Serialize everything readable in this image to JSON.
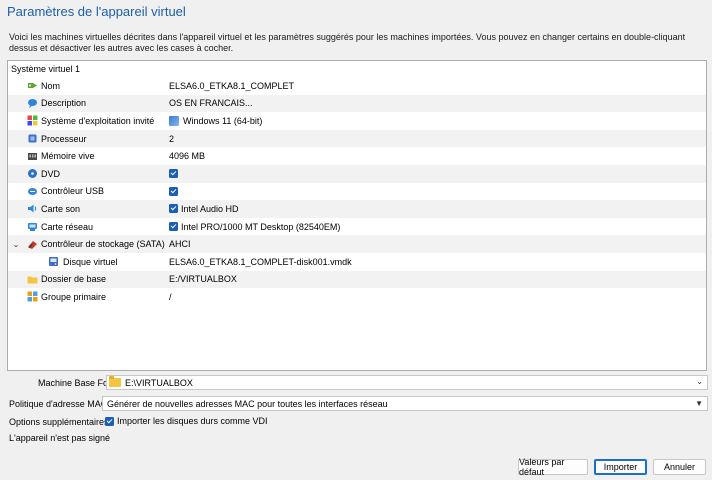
{
  "window": {
    "title": "Paramètres de l'appareil virtuel",
    "description": "Voici les machines virtuelles décrites dans l'appareil virtuel et les paramètres suggérés pour les machines importées. Vous pouvez en changer certains en double-cliquant dessus et désactiver les autres avec les cases à cocher."
  },
  "system": {
    "label": "Système virtuel 1",
    "rows": [
      {
        "name": "nom",
        "icon": "name-tag-icon",
        "label": "Nom",
        "value": "ELSA6.0_ETKA8.1_COMPLET"
      },
      {
        "name": "description",
        "icon": "speech-bubble-icon",
        "label": "Description",
        "value": "OS EN FRANCAIS..."
      },
      {
        "name": "guest-os",
        "icon": "os-windows-icon",
        "label": "Système d'exploitation invité",
        "value": "Windows 11 (64-bit)"
      },
      {
        "name": "processor",
        "icon": "cpu-icon",
        "label": "Processeur",
        "value": "2"
      },
      {
        "name": "memory",
        "icon": "ram-icon",
        "label": "Mémoire vive",
        "value": "4096 MB"
      },
      {
        "name": "dvd",
        "icon": "dvd-icon",
        "label": "DVD",
        "value": ""
      },
      {
        "name": "usb",
        "icon": "usb-icon",
        "label": "Contrôleur USB",
        "value": ""
      },
      {
        "name": "sound",
        "icon": "speaker-icon",
        "label": "Carte son",
        "value": "Intel Audio HD"
      },
      {
        "name": "network",
        "icon": "network-icon",
        "label": "Carte réseau",
        "value": "Intel PRO/1000 MT Desktop (82540EM)"
      },
      {
        "name": "storage-controller",
        "icon": "storage-controller-icon",
        "label": "Contrôleur de stockage (SATA)",
        "value": "AHCI"
      },
      {
        "name": "virtual-disk",
        "icon": "hard-disk-icon",
        "label": "Disque virtuel",
        "value": "ELSA6.0_ETKA8.1_COMPLET-disk001.vmdk"
      },
      {
        "name": "base-folder",
        "icon": "folder-icon",
        "label": "Dossier de base",
        "value": "E:/VIRTUALBOX"
      },
      {
        "name": "primary-group",
        "icon": "group-icon",
        "label": "Groupe primaire",
        "value": "/"
      }
    ]
  },
  "bottom": {
    "machine_base_folder_label": "Machine Base Folder:",
    "machine_base_folder_value": "E:\\VIRTUALBOX",
    "mac_policy_label": "Politique d'adresse MAC :",
    "mac_policy_value": "Générer de nouvelles adresses MAC pour toutes les interfaces réseau",
    "options_label": "Options supplémentaires :",
    "import_vdi_label": "Importer les disques durs comme VDI",
    "unsigned_text": "L'appareil n'est pas signé"
  },
  "buttons": {
    "defaults": "Valeurs par défaut",
    "import": "Importer",
    "cancel": "Annuler"
  },
  "colors": {
    "accent": "#1a5fb4",
    "title": "#1a5fa8"
  }
}
